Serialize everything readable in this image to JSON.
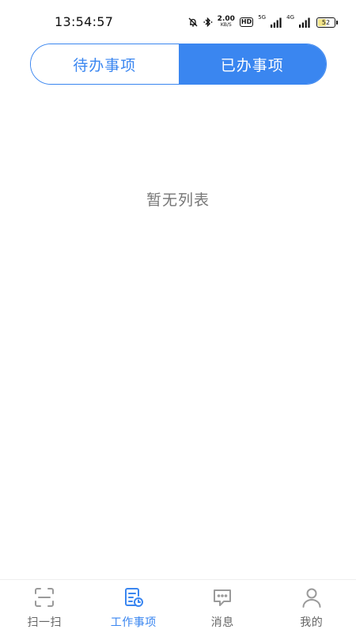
{
  "status_bar": {
    "time": "13:54:57",
    "net_speed_value": "2.00",
    "net_speed_unit": "KB/S",
    "hd_label": "HD",
    "sim1_label": "5G",
    "sim2_label": "4G",
    "battery_level": "52",
    "battery_fraction": 0.52
  },
  "tabs": [
    {
      "label": "待办事项",
      "active": false
    },
    {
      "label": "已办事项",
      "active": true
    }
  ],
  "empty_state": {
    "text": "暂无列表"
  },
  "bottom_nav": {
    "items": [
      {
        "label": "扫一扫",
        "icon": "scan-icon",
        "active": false
      },
      {
        "label": "工作事项",
        "icon": "work-items-icon",
        "active": true
      },
      {
        "label": "消息",
        "icon": "message-icon",
        "active": false
      },
      {
        "label": "我的",
        "icon": "profile-icon",
        "active": false
      }
    ]
  },
  "colors": {
    "accent": "#3a86f0",
    "inactive_nav": "#666666",
    "empty_text": "#777777",
    "battery_fill": "#f3e48a"
  }
}
